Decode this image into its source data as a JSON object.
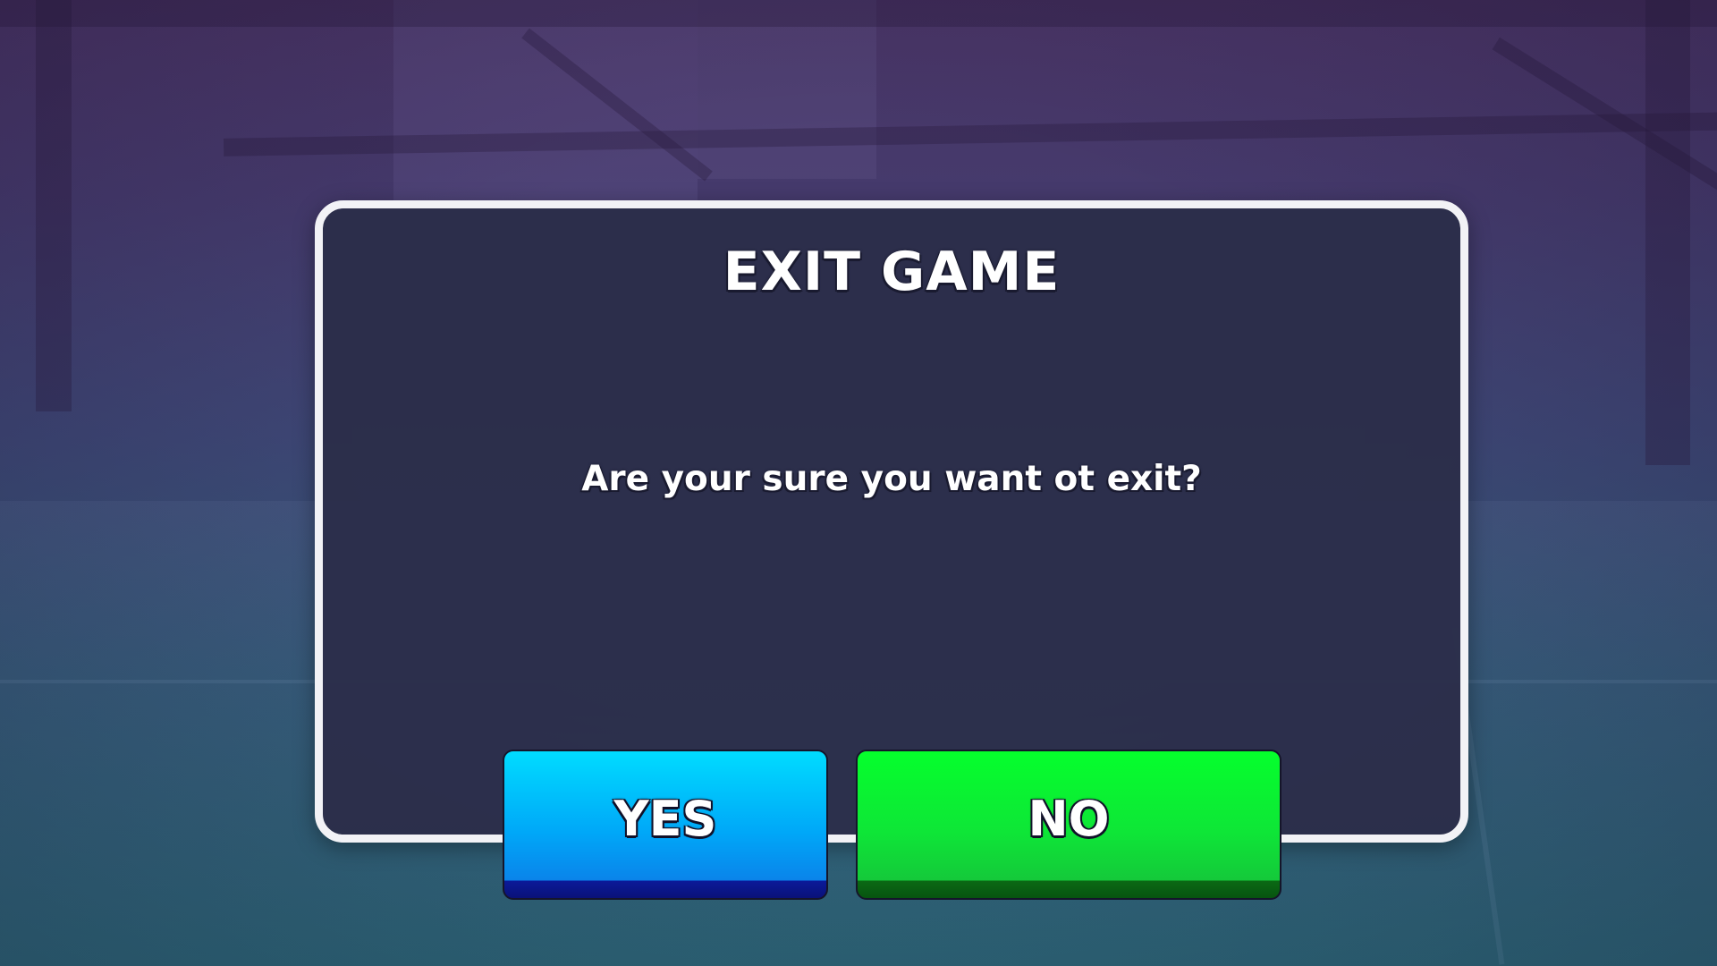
{
  "dialog": {
    "title": "EXIT GAME",
    "message": "Are your sure you want ot exit?"
  },
  "buttons": {
    "yes_label": "YES",
    "no_label": "NO"
  },
  "colors": {
    "background_top": "#4a3566",
    "background_bottom": "#2e6878",
    "dialog_fill": "#2c2e4a",
    "dialog_border": "#f2f2f6",
    "yes_button": "#00b4f8",
    "no_button": "#0ee637"
  }
}
